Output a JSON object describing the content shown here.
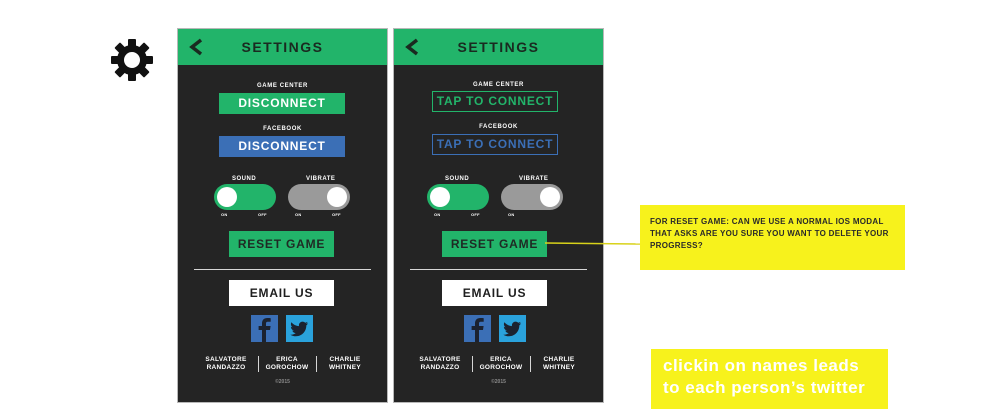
{
  "colors": {
    "accent_green": "#22b46a",
    "facebook_blue": "#3b6fb6",
    "twitter_blue": "#2aa2dc",
    "screen_bg": "#242424",
    "note_yellow": "#f7f21c"
  },
  "side_icon": "gear-icon",
  "screens": [
    {
      "header": {
        "title": "SETTINGS",
        "back_icon": "back-arrow-icon"
      },
      "game_center": {
        "label": "GAME CENTER",
        "button": "DISCONNECT"
      },
      "facebook": {
        "label": "FACEBOOK",
        "button": "DISCONNECT"
      },
      "sound": {
        "label": "SOUND",
        "state_on": "ON",
        "state_off": "OFF",
        "value": "on"
      },
      "vibrate": {
        "label": "VIBRATE",
        "state_on": "ON",
        "state_off": "OFF",
        "value": "off"
      },
      "reset_button": "RESET GAME",
      "email_button": "EMAIL US",
      "social_icons": [
        "facebook-icon",
        "twitter-icon"
      ],
      "credits": [
        {
          "first": "SALVATORE",
          "last": "RANDAZZO"
        },
        {
          "first": "ERICA",
          "last": "GOROCHOW"
        },
        {
          "first": "CHARLIE",
          "last": "WHITNEY"
        }
      ],
      "copyright": "©2015"
    },
    {
      "header": {
        "title": "SETTINGS",
        "back_icon": "back-arrow-icon"
      },
      "game_center": {
        "label": "GAME CENTER",
        "button": "TAP TO CONNECT"
      },
      "facebook": {
        "label": "FACEBOOK",
        "button": "TAP TO CONNECT"
      },
      "sound": {
        "label": "SOUND",
        "state_on": "ON",
        "state_off": "OFF",
        "value": "on"
      },
      "vibrate": {
        "label": "VIBRATE",
        "state_on": "ON",
        "value": "off"
      },
      "reset_button": "RESET GAME",
      "email_button": "EMAIL US",
      "social_icons": [
        "facebook-icon",
        "twitter-icon"
      ],
      "credits": [
        {
          "first": "SALVATORE",
          "last": "RANDAZZO"
        },
        {
          "first": "ERICA",
          "last": "GOROCHOW"
        },
        {
          "first": "CHARLIE",
          "last": "WHITNEY"
        }
      ],
      "copyright": "©2015"
    }
  ],
  "notes": {
    "reset_game": "FOR RESET GAME: CAN WE USE A NORMAL IOS MODAL THAT ASKS ARE YOU SURE YOU WANT TO DELETE YOUR PROGRESS?",
    "names_line1": "clickin on names leads",
    "names_line2": "to each person’s twitter"
  }
}
